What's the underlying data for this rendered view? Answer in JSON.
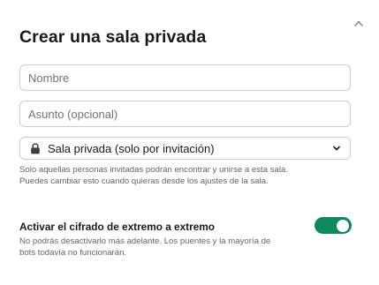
{
  "dialog": {
    "title": "Crear una sala privada",
    "close_icon": "close-icon"
  },
  "form": {
    "name_placeholder": "Nombre",
    "name_value": "",
    "topic_placeholder": "Asunto (opcional)",
    "topic_value": "",
    "visibility": {
      "icon": "lock-icon",
      "selected": "Sala privada (solo por invitación)",
      "help": "Solo aquellas personas invitadas podrán encontrar y unirse a esta sala. Puedes cambiar esto cuando quieras desde los ajustes de la sala."
    },
    "encryption": {
      "label": "Activar el cifrado de extremo a extremo",
      "enabled": true,
      "help": "No podrás desactivarlo más adelante. Los puentes y la mayoría de bots todavía no funcionarán."
    }
  },
  "colors": {
    "accent": "#0d8a5c",
    "text_primary": "#17191c",
    "text_secondary": "#5f6570",
    "border": "#c9ccd1"
  }
}
